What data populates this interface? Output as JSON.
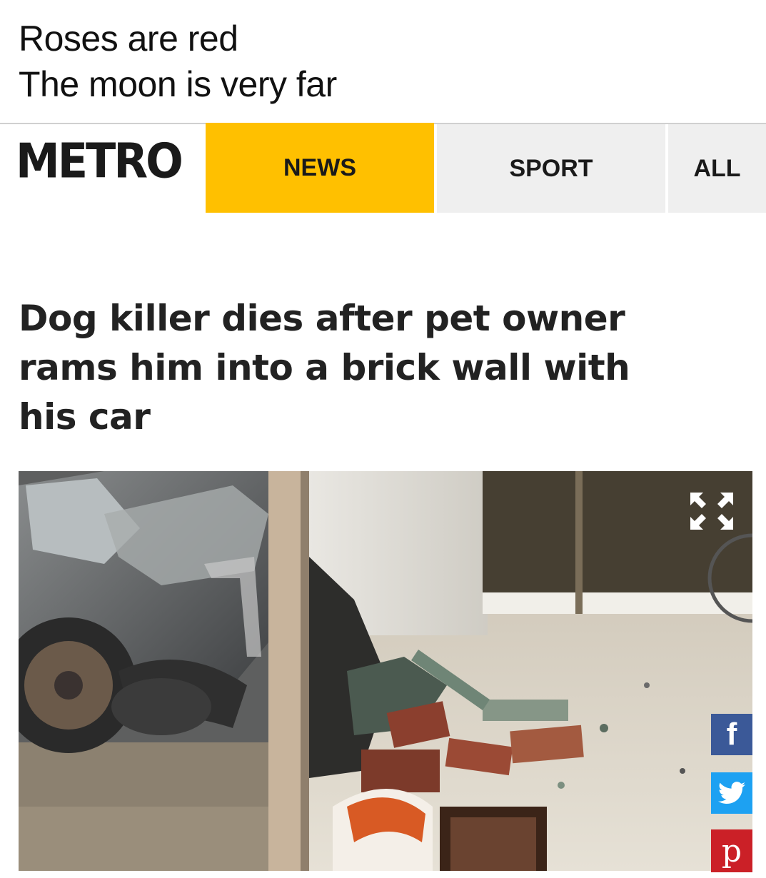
{
  "caption": {
    "line1": "Roses are red",
    "line2": "The moon is very far"
  },
  "navbar": {
    "logo": "METRO",
    "tabs": [
      {
        "label": "NEWS",
        "active": true
      },
      {
        "label": "SPORT",
        "active": false
      },
      {
        "label": "ALL",
        "active": false
      }
    ],
    "active_color": "#ffc000",
    "inactive_color": "#efefef"
  },
  "article": {
    "headline_lines": [
      "Dog killer dies after pet owner",
      "rams him into a brick wall with",
      "his car"
    ],
    "image": "photo of crashed car, brick rubble and broken glass"
  },
  "share": {
    "facebook": {
      "icon": "facebook-icon",
      "glyph": "f",
      "color": "#3b5998"
    },
    "twitter": {
      "icon": "twitter-icon",
      "color": "#1da1f2"
    },
    "pinterest": {
      "icon": "pinterest-icon",
      "glyph": "p",
      "color": "#cb2027"
    }
  },
  "expand": {
    "icon": "expand-icon"
  }
}
